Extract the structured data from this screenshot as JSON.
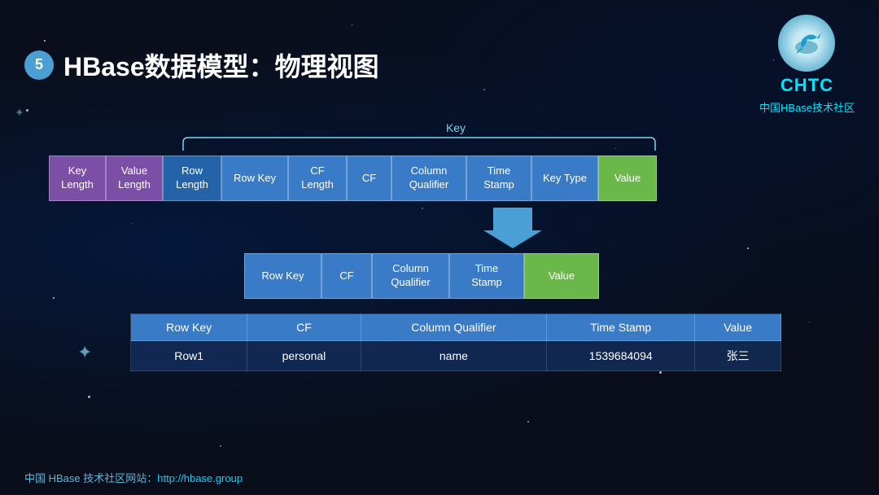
{
  "header": {
    "step_number": "5",
    "title": "HBase数据模型：物理视图",
    "brand": {
      "name": "CHTC",
      "subtitle": "中国HBase技术社区"
    }
  },
  "key_label": "Key",
  "physical_row": {
    "cells": [
      {
        "label": "Key\nLength",
        "type": "purple",
        "width": 70
      },
      {
        "label": "Value\nLength",
        "type": "purple",
        "width": 70
      },
      {
        "label": "Row\nLength",
        "type": "blue-dark",
        "width": 70
      },
      {
        "label": "Row Key",
        "type": "blue-mid",
        "width": 80
      },
      {
        "label": "CF\nLength",
        "type": "blue-mid",
        "width": 70
      },
      {
        "label": "CF",
        "type": "blue-mid",
        "width": 55
      },
      {
        "label": "Column\nQualifier",
        "type": "blue-mid",
        "width": 90
      },
      {
        "label": "Time\nStamp",
        "type": "blue-mid",
        "width": 80
      },
      {
        "label": "Key Type",
        "type": "blue-mid",
        "width": 80
      },
      {
        "label": "Value",
        "type": "green",
        "width": 70
      }
    ]
  },
  "logical_row": {
    "cells": [
      {
        "label": "Row Key",
        "type": "blue-mid",
        "width": 90
      },
      {
        "label": "CF",
        "type": "blue-mid",
        "width": 60
      },
      {
        "label": "Column\nQualifier",
        "type": "blue-mid",
        "width": 90
      },
      {
        "label": "Time\nStamp",
        "type": "blue-mid",
        "width": 90
      },
      {
        "label": "Value",
        "type": "green",
        "width": 90
      }
    ]
  },
  "table": {
    "headers": [
      "Row Key",
      "CF",
      "Column Qualifier",
      "Time Stamp",
      "Value"
    ],
    "rows": [
      [
        "Row1",
        "personal",
        "name",
        "1539684094",
        "张三"
      ]
    ]
  },
  "footer": {
    "text": "中国 HBase 技术社区网站：",
    "link_text": "http://hbase.group",
    "link_url": "http://hbase.group"
  }
}
